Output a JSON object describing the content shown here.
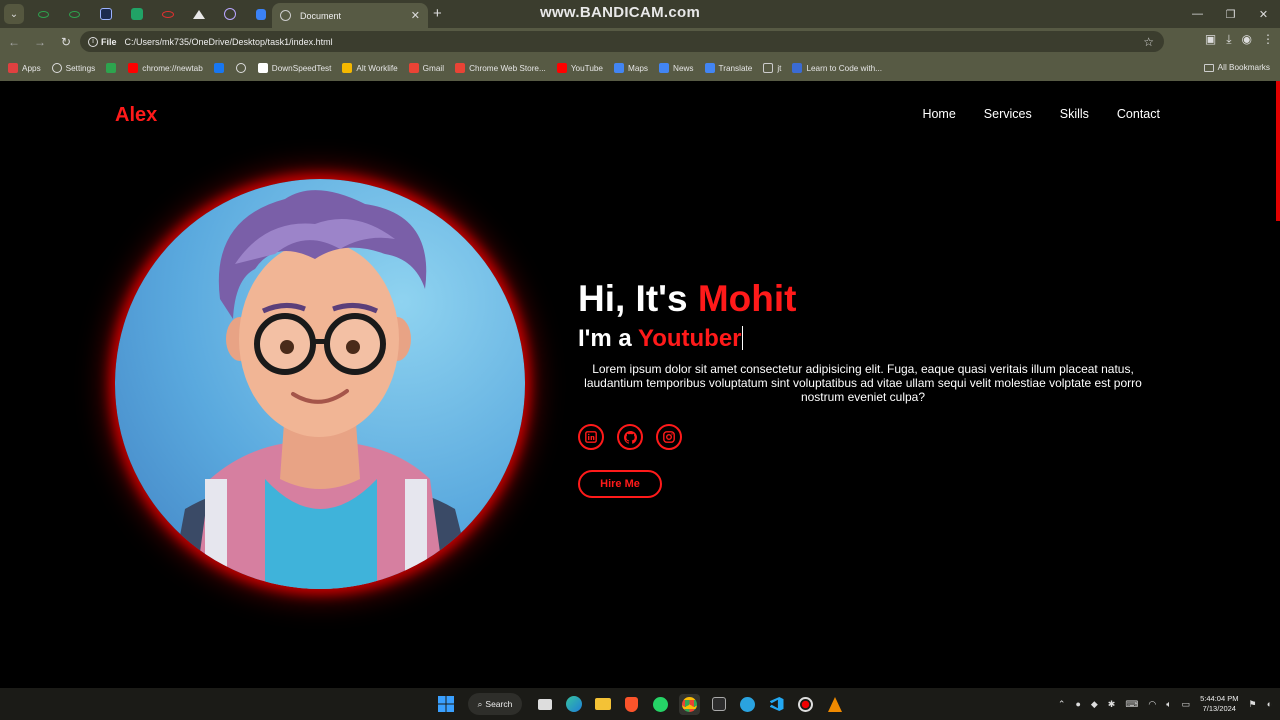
{
  "browser": {
    "watermark": "www.BANDICAM.com",
    "active_tab": {
      "title": "Document"
    },
    "new_tab_symbol": "+",
    "address": {
      "scheme": "File",
      "url": "C:/Users/mk735/OneDrive/Desktop/task1/index.html"
    },
    "bookmarks": [
      {
        "label": "Apps",
        "icon": "apps-grid-icon",
        "color": "#e04040"
      },
      {
        "label": "Settings",
        "icon": "gear-icon",
        "color": "#dddddd"
      },
      {
        "label": "",
        "icon": "chrome-icon",
        "color": "#2da44e"
      },
      {
        "label": "chrome://newtab",
        "icon": "youtube-icon",
        "color": "#ff0000"
      },
      {
        "label": "",
        "icon": "facebook-icon",
        "color": "#1877f2"
      },
      {
        "label": "",
        "icon": "globe-icon",
        "color": "#dddddd"
      },
      {
        "label": "DownSpeedTest",
        "icon": "speedtest-icon",
        "color": "#ffffff"
      },
      {
        "label": "Alt Worklife",
        "icon": "alt-worklife-icon",
        "color": "#f5b800"
      },
      {
        "label": "Gmail",
        "icon": "gmail-icon",
        "color": "#ea4335"
      },
      {
        "label": "Chrome Web Store...",
        "icon": "web-store-icon",
        "color": "#ea4335"
      },
      {
        "label": "YouTube",
        "icon": "youtube-icon",
        "color": "#ff0000"
      },
      {
        "label": "Maps",
        "icon": "maps-icon",
        "color": "#4285f4"
      },
      {
        "label": "News",
        "icon": "news-icon",
        "color": "#4285f4"
      },
      {
        "label": "Translate",
        "icon": "translate-icon",
        "color": "#4285f4"
      },
      {
        "label": "jt",
        "icon": "folder-icon",
        "color": "#cccccc"
      },
      {
        "label": "Learn to Code with...",
        "icon": "code-icon",
        "color": "#3b6bd4"
      }
    ],
    "all_bookmarks": "All Bookmarks"
  },
  "site": {
    "logo": "Alex",
    "nav": [
      "Home",
      "Services",
      "Skills",
      "Contact"
    ],
    "hero": {
      "greeting": "Hi, It's ",
      "name": "Mohit",
      "role_prefix": "I'm a ",
      "role": "Youtuber",
      "description": "Lorem ipsum dolor sit amet consectetur adipisicing elit. Fuga, eaque quasi veritais illum placeat natus, laudantium temporibus voluptatum sint voluptatibus ad vitae ullam sequi velit molestiae volptate est porro nostrum eveniet culpa?",
      "cta": "Hire Me"
    },
    "social": [
      "linkedin-icon",
      "github-icon",
      "instagram-icon"
    ],
    "accent": "#ff1a1a"
  },
  "taskbar": {
    "search_label": "Search",
    "time": "5:44:04 PM",
    "date": "7/13/2024"
  }
}
